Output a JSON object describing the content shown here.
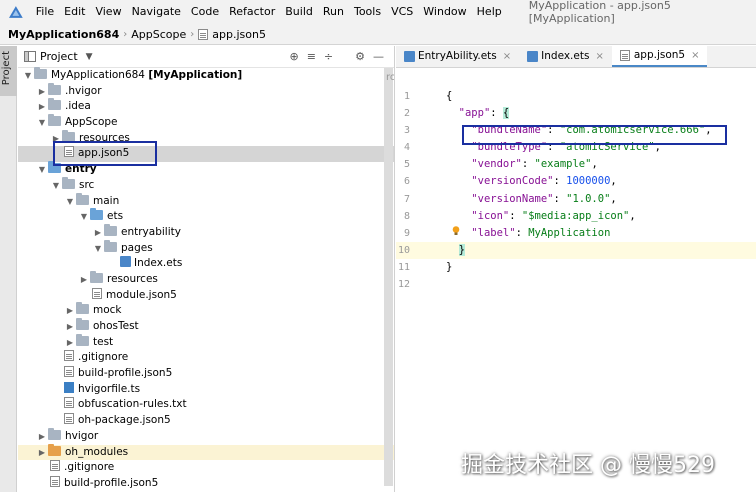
{
  "window": {
    "title": "MyApplication - app.json5 [MyApplication]",
    "menu": [
      "File",
      "Edit",
      "View",
      "Navigate",
      "Code",
      "Refactor",
      "Build",
      "Run",
      "Tools",
      "VCS",
      "Window",
      "Help"
    ]
  },
  "breadcrumb": {
    "project": "MyApplication684",
    "folder": "AppScope",
    "file": "app.json5"
  },
  "toolstrip": {
    "label": "Project"
  },
  "project_panel": {
    "title": "Project",
    "read_only_marker": "ro",
    "tree": [
      {
        "label": "MyApplication684",
        "suffix": "[MyApplication]"
      },
      {
        "label": ".hvigor"
      },
      {
        "label": ".idea"
      },
      {
        "label": "AppScope"
      },
      {
        "label": "resources"
      },
      {
        "label": "app.json5"
      },
      {
        "label": "entry"
      },
      {
        "label": "src"
      },
      {
        "label": "main"
      },
      {
        "label": "ets"
      },
      {
        "label": "entryability"
      },
      {
        "label": "pages"
      },
      {
        "label": "Index.ets"
      },
      {
        "label": "resources"
      },
      {
        "label": "module.json5"
      },
      {
        "label": "mock"
      },
      {
        "label": "ohosTest"
      },
      {
        "label": "test"
      },
      {
        "label": ".gitignore"
      },
      {
        "label": "build-profile.json5"
      },
      {
        "label": "hvigorfile.ts"
      },
      {
        "label": "obfuscation-rules.txt"
      },
      {
        "label": "oh-package.json5"
      },
      {
        "label": "hvigor"
      },
      {
        "label": "oh_modules"
      },
      {
        "label": ".gitignore"
      },
      {
        "label": "build-profile.json5"
      }
    ]
  },
  "editor": {
    "tabs": [
      {
        "label": "EntryAbility.ets"
      },
      {
        "label": "Index.ets"
      },
      {
        "label": "app.json5"
      }
    ],
    "line_numbers": [
      "1",
      "2",
      "3",
      "4",
      "5",
      "6",
      "7",
      "8",
      "9",
      "10",
      "11",
      "12"
    ],
    "code": {
      "l1": "{",
      "l2_key": "\"app\"",
      "l2_rest": ": ",
      "l2_brace": "{",
      "l3_key": "\"bundleName\"",
      "l3_val": "\"com.atomicservice.666\"",
      "l4_key": "\"bundleType\"",
      "l4_val": "\"atomicService\"",
      "l5_key": "\"vendor\"",
      "l5_val": "\"example\"",
      "l6_key": "\"versionCode\"",
      "l6_val": "1000000",
      "l7_key": "\"versionName\"",
      "l7_val": "\"1.0.0\"",
      "l8_key": "\"icon\"",
      "l8_val": "\"$media:app_icon\"",
      "l9_key": "\"label\"",
      "l9_val": "MyApplication",
      "l10": "}",
      "l11": "}"
    }
  },
  "watermark": "掘金技术社区 @ 慢慢529"
}
